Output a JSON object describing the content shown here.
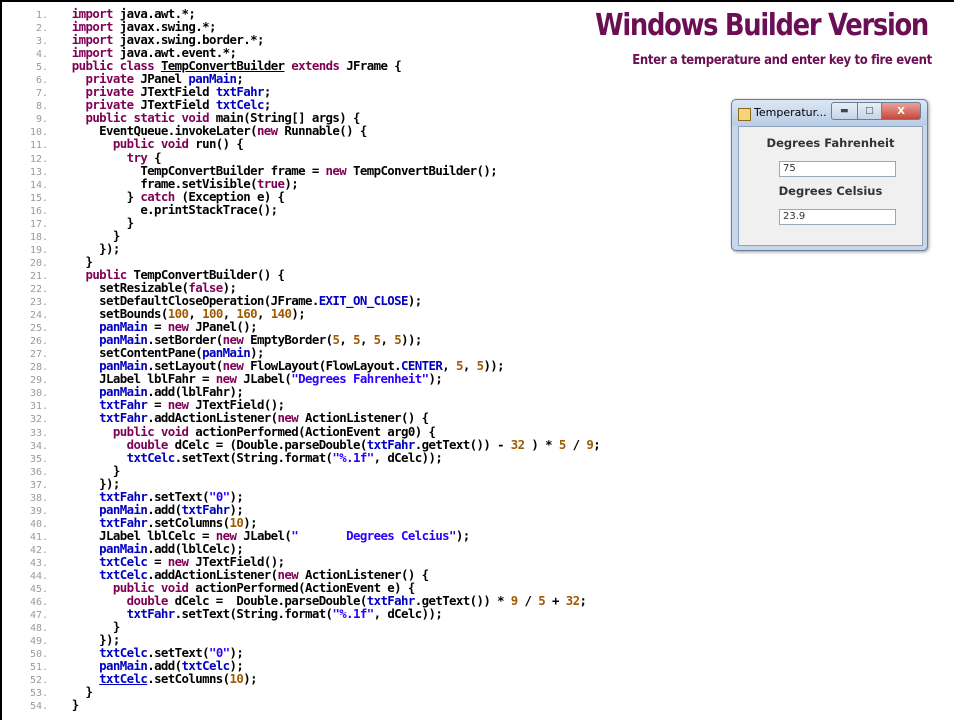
{
  "slide": {
    "title": "Windows Builder Version",
    "subtitle": "Enter a temperature and enter key to fire event"
  },
  "window": {
    "title": "Temperatur...",
    "label_fahr": "Degrees Fahrenheit",
    "value_fahr": "75",
    "label_celc": "Degrees Celsius",
    "value_celc": "23.9",
    "buttons": {
      "minimize": "▬",
      "maximize": "□",
      "close": "X"
    }
  },
  "code": {
    "line_numbers": [
      "1.",
      "2.",
      "3.",
      "4.",
      "5.",
      "6.",
      "7.",
      "8.",
      "9.",
      "10.",
      "11.",
      "12.",
      "13.",
      "14.",
      "15.",
      "16.",
      "17.",
      "18.",
      "19.",
      "20.",
      "21.",
      "22.",
      "23.",
      "24.",
      "25.",
      "26.",
      "27.",
      "28.",
      "29.",
      "30.",
      "31.",
      "32.",
      "33.",
      "34.",
      "35.",
      "36.",
      "37.",
      "38.",
      "39.",
      "40.",
      "41.",
      "42.",
      "43.",
      "44.",
      "45.",
      "46.",
      "47.",
      "48.",
      "49.",
      "50.",
      "51.",
      "52.",
      "53.",
      "54."
    ]
  }
}
